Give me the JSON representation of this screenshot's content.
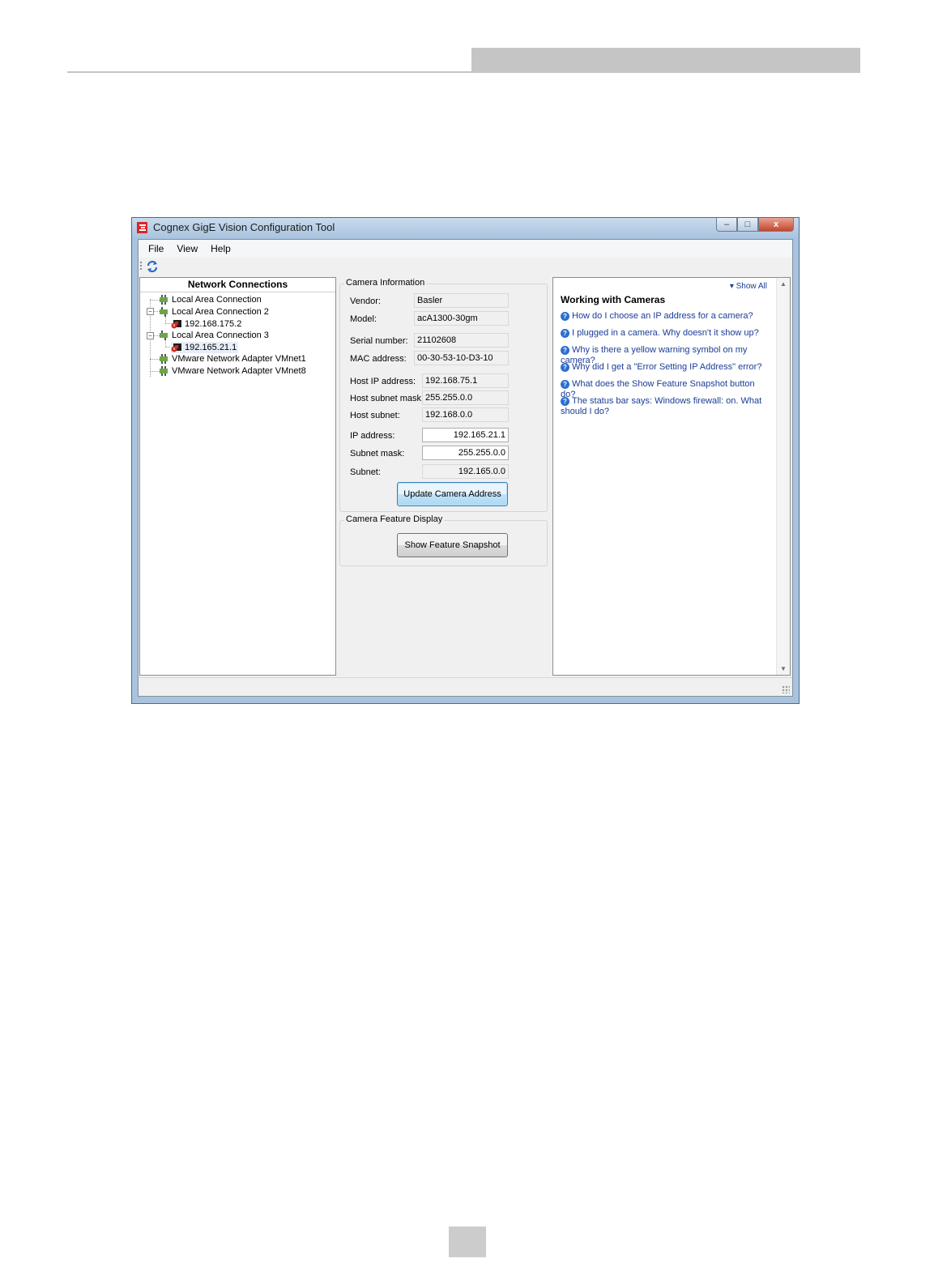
{
  "window": {
    "title": "Cognex GigE Vision Configuration Tool",
    "controls": {
      "minimize": "–",
      "maximize": "□",
      "close": "x"
    }
  },
  "menu": {
    "file": "File",
    "view": "View",
    "help": "Help"
  },
  "toolbar": {
    "refresh_icon": "refresh-icon"
  },
  "network_pane": {
    "header": "Network Connections",
    "items": [
      {
        "label": "Local Area Connection",
        "level": 0
      },
      {
        "label": "Local Area Connection 2",
        "level": 0
      },
      {
        "label": "192.168.175.2",
        "level": 1
      },
      {
        "label": "Local Area Connection 3",
        "level": 0
      },
      {
        "label": "192.165.21.1",
        "level": 1
      },
      {
        "label": "VMware Network Adapter VMnet1",
        "level": 0
      },
      {
        "label": "VMware Network Adapter VMnet8",
        "level": 0
      }
    ]
  },
  "camera_info": {
    "group_label": "Camera Information",
    "vendor_label": "Vendor:",
    "vendor": "Basler",
    "model_label": "Model:",
    "model": "acA1300-30gm",
    "serial_label": "Serial number:",
    "serial": "21102608",
    "mac_label": "MAC address:",
    "mac": "00-30-53-10-D3-10",
    "host_ip_label": "Host IP address:",
    "host_ip": "192.168.75.1",
    "host_mask_label": "Host subnet mask:",
    "host_mask": "255.255.0.0",
    "host_subnet_label": "Host subnet:",
    "host_subnet": "192.168.0.0",
    "ip_label": "IP address:",
    "ip": "192.165.21.1",
    "mask_label": "Subnet mask:",
    "mask": "255.255.0.0",
    "subnet_label": "Subnet:",
    "subnet": "192.165.0.0",
    "update_button": "Update Camera Address"
  },
  "feature_display": {
    "group_label": "Camera Feature Display",
    "snapshot_button": "Show Feature Snapshot"
  },
  "help_pane": {
    "show_all": "Show All",
    "title": "Working with Cameras",
    "links": [
      "How do I choose an IP address for a camera?",
      "I plugged in a camera. Why doesn't it show up?",
      "Why is there a yellow warning symbol on my camera?",
      "Why did I get a \"Error Setting IP Address\" error?",
      "What does the Show Feature Snapshot button do?",
      "The status bar says: Windows firewall: on. What should I do?"
    ]
  }
}
